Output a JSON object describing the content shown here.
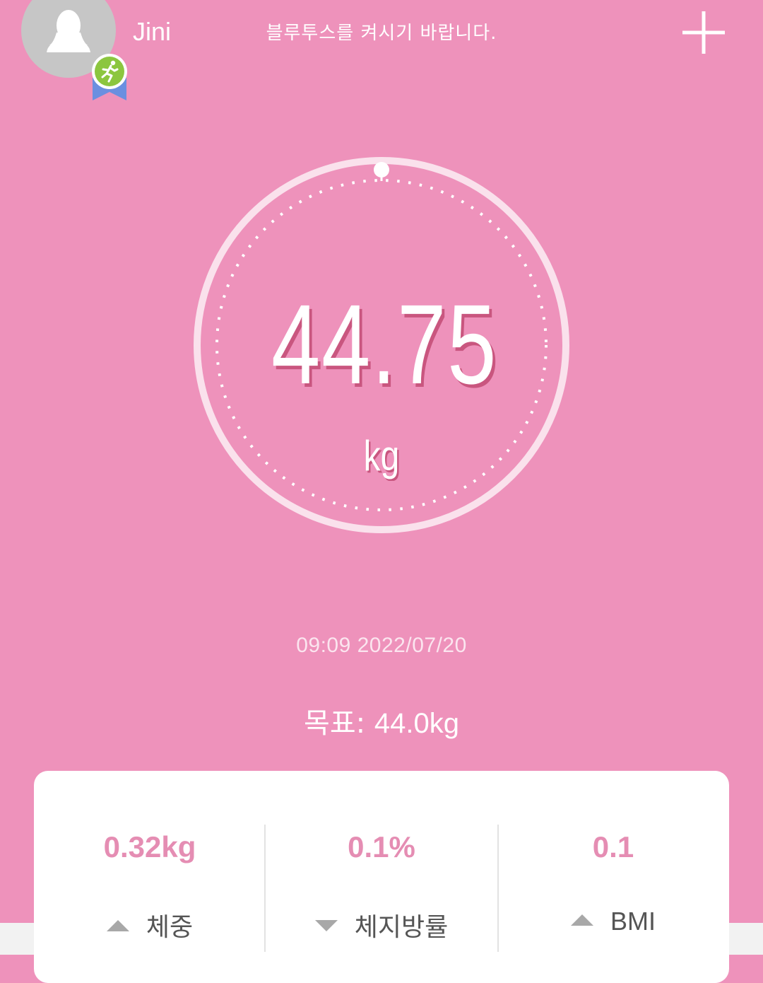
{
  "header": {
    "user_name": "Jini",
    "bluetooth_notice": "블루투스를 켜시기 바랍니다.",
    "avatar_icon": "user-silhouette-icon",
    "badge_icon": "runner-badge-icon",
    "add_icon": "plus-icon"
  },
  "measurement": {
    "weight": "44.75",
    "unit": "kg",
    "timestamp": "09:09 2022/07/20",
    "goal_label": "목표:",
    "goal_value": "44.0kg"
  },
  "stats": [
    {
      "value": "0.32kg",
      "direction": "up",
      "label": "체중"
    },
    {
      "value": "0.1%",
      "direction": "down",
      "label": "체지방률"
    },
    {
      "value": "0.1",
      "direction": "up",
      "label": "BMI"
    }
  ],
  "colors": {
    "background": "#EE92BB",
    "accent_text": "#E58DB3",
    "card": "#FFFFFF",
    "arrow": "#A8A8A8"
  }
}
